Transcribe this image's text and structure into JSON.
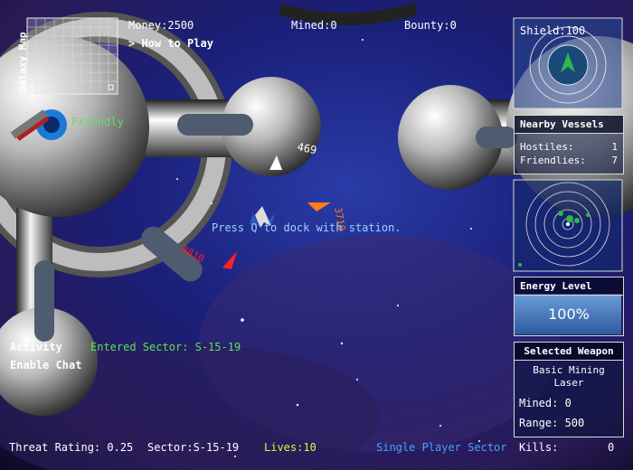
{
  "hud": {
    "money": "Money:2500",
    "mined": "Mined:0",
    "bounty": "Bounty:0",
    "how_to_play": "> How to Play"
  },
  "galaxy_map": {
    "label": "Galaxy Map"
  },
  "friendly_label": "Friendly",
  "message": "Press Q to dock with station.",
  "markers": {
    "white_distance": "469",
    "orange_distance": "3710",
    "red_distance": "8810"
  },
  "activity": {
    "label": "Activity",
    "entry": "Entered Sector: S-15-19",
    "enable_chat": "Enable Chat"
  },
  "shield": {
    "label": "Shield:100"
  },
  "nearby": {
    "title": "Nearby Vessels",
    "hostiles_label": "Hostiles:",
    "hostiles": "1",
    "friendlies_label": "Friendlies:",
    "friendlies": "7"
  },
  "energy": {
    "title": "Energy Level",
    "value": "100%"
  },
  "weapon": {
    "title": "Selected Weapon",
    "name": "Basic Mining Laser",
    "mined": "Mined: 0",
    "range": "Range: 500"
  },
  "bottom": {
    "threat": "Threat Rating: 0.25",
    "sector": "Sector:S-15-19",
    "lives": "Lives:10",
    "mode": "Single Player Sector",
    "kills_label": "Kills:",
    "kills": "0"
  },
  "colors": {
    "green": "#5fe05f",
    "blue": "#4aa0ff",
    "orange": "#ff7a1a",
    "red": "#ff2020"
  }
}
